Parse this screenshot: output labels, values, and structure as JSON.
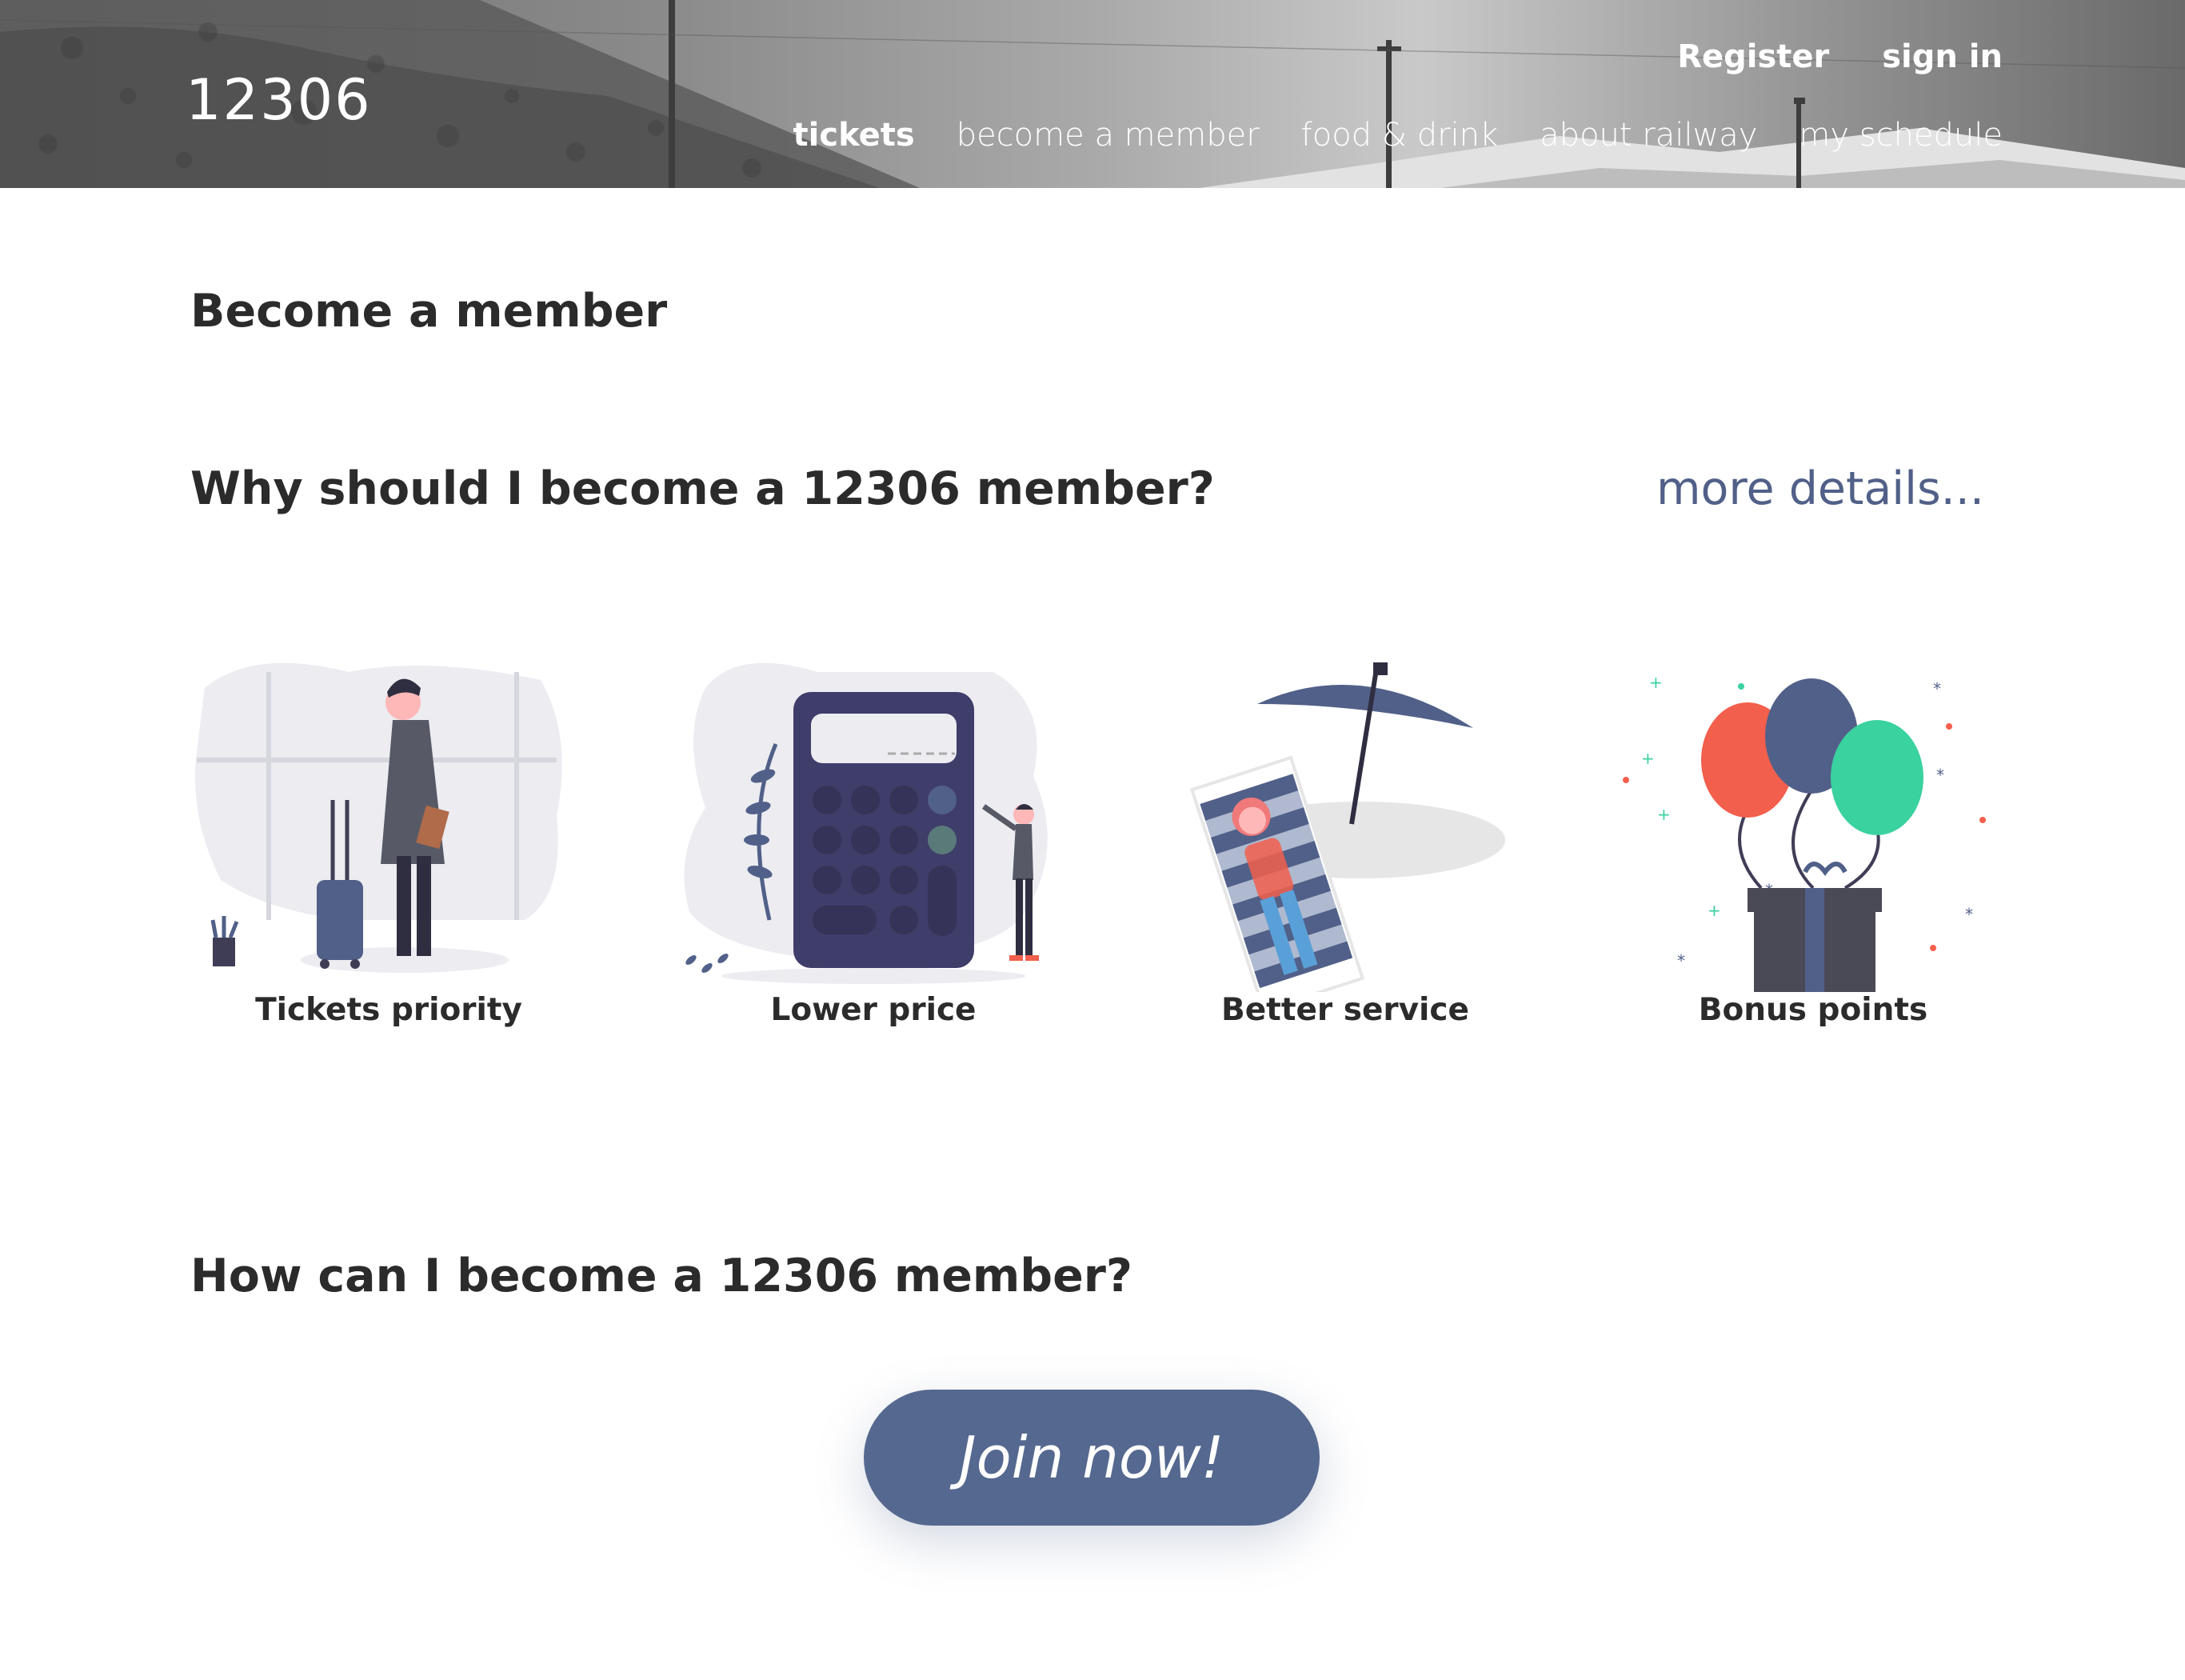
{
  "header": {
    "logo": "12306",
    "auth": {
      "register": "Register",
      "sign_in": "sign in"
    },
    "nav": [
      "tickets",
      "become a member",
      "food & drink",
      "about railway",
      "my schedule"
    ],
    "active_nav": "tickets"
  },
  "main": {
    "page_title": "Become a member",
    "why_heading": "Why should I become a 12306 member?",
    "more_details": "more details...",
    "features": [
      {
        "label": "Tickets priority",
        "icon": "traveler-with-suitcase-illustration"
      },
      {
        "label": "Lower price",
        "icon": "calculator-illustration"
      },
      {
        "label": "Better service",
        "icon": "beach-umbrella-illustration"
      },
      {
        "label": "Bonus points",
        "icon": "balloons-gift-illustration"
      }
    ],
    "how_heading": "How can I become a 12306 member?",
    "join_button": "Join now!"
  },
  "colors": {
    "accent": "#55688f",
    "link": "#516088",
    "text": "#2b2b2b",
    "balloon_red": "#f25f4c",
    "balloon_blue": "#516088",
    "balloon_green": "#3ad29f",
    "calculator": "#3f3d6a"
  }
}
